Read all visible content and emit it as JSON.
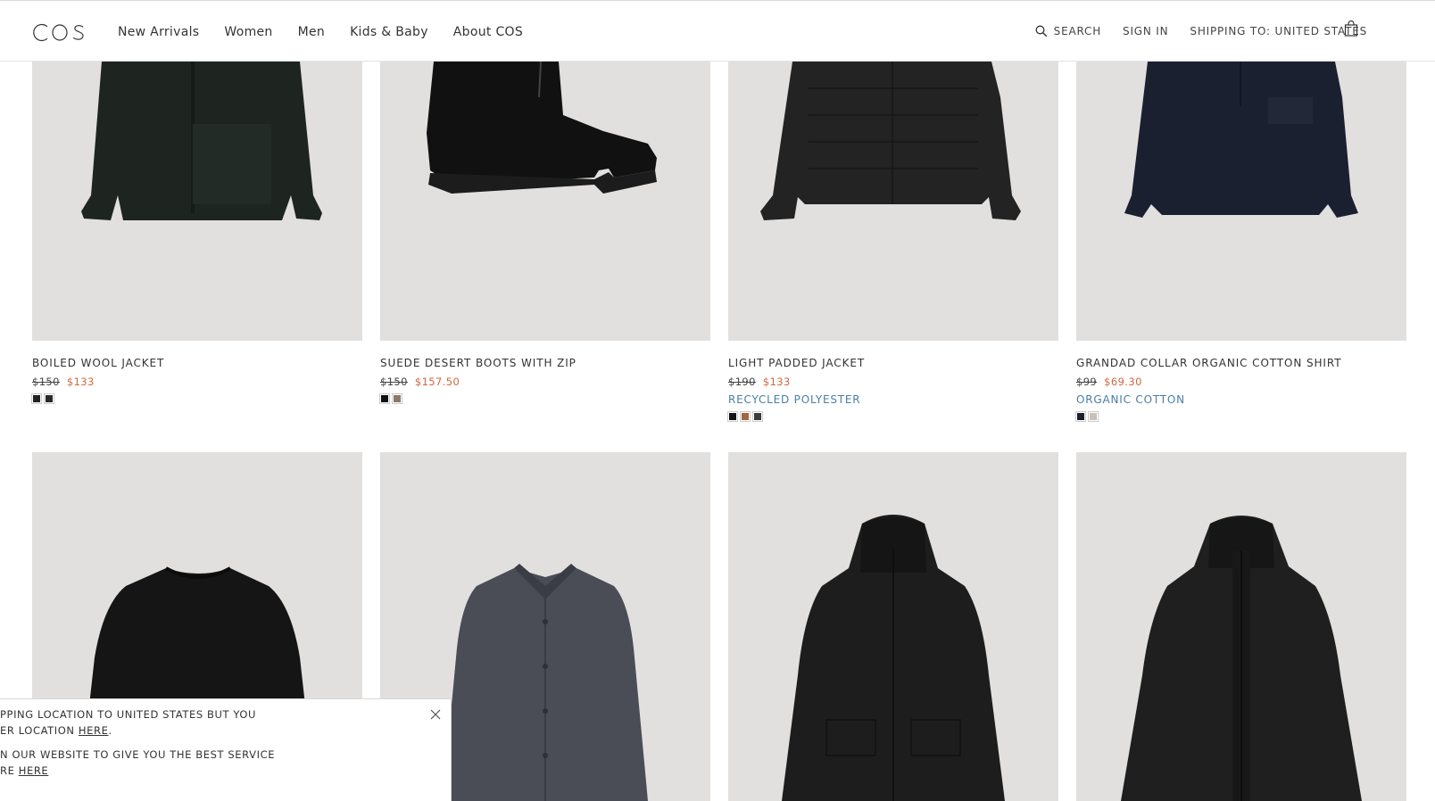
{
  "header": {
    "logo_text": "COS",
    "nav": [
      "New Arrivals",
      "Women",
      "Men",
      "Kids & Baby",
      "About COS"
    ],
    "search_label": "SEARCH",
    "signin_label": "SIGN IN",
    "shipping_label": "SHIPPING TO: UNITED STATES",
    "icons": [
      "search-icon",
      "shopping-bag-icon"
    ]
  },
  "products": [
    {
      "name": "BOILED WOOL JACKET",
      "old_price": "$150",
      "price": "$133",
      "tag": "",
      "swatches": [
        "#1f2420",
        "#2a2a2a"
      ]
    },
    {
      "name": "SUEDE DESERT BOOTS WITH ZIP",
      "old_price": "$150",
      "price": "$157.50",
      "tag": "",
      "swatches": [
        "#111111",
        "#8d7a66"
      ]
    },
    {
      "name": "LIGHT PADDED JACKET",
      "old_price": "$190",
      "price": "$133",
      "tag": "RECYCLED POLYESTER",
      "swatches": [
        "#151515",
        "#a3673f",
        "#3a3c40"
      ]
    },
    {
      "name": "GRANDAD COLLAR ORGANIC COTTON SHIRT",
      "old_price": "$99",
      "price": "$69.30",
      "tag": "ORGANIC COTTON",
      "swatches": [
        "#1b2030",
        "#c9c1b8"
      ]
    },
    {
      "name": "",
      "old_price": "",
      "price": "",
      "tag": "",
      "swatches": []
    },
    {
      "name": "",
      "old_price": "",
      "price": "",
      "tag": "",
      "swatches": []
    },
    {
      "name": "",
      "old_price": "",
      "price": "",
      "tag": "",
      "swatches": []
    },
    {
      "name": "",
      "old_price": "",
      "price": "",
      "tag": "",
      "swatches": []
    }
  ],
  "notice": {
    "line1": "PPING LOCATION TO UNITED STATES BUT YOU",
    "line2_prefix": "ER LOCATION ",
    "line2_link": "HERE",
    "line2_suffix": ".",
    "line3": "N OUR WEBSITE TO GIVE YOU THE BEST SERVICE",
    "line4_prefix": "RE ",
    "line4_link": "HERE"
  },
  "colors": {
    "sale_price": "#d4663e",
    "material_tag": "#4a7ea8",
    "image_bg": "#e1e0de"
  }
}
